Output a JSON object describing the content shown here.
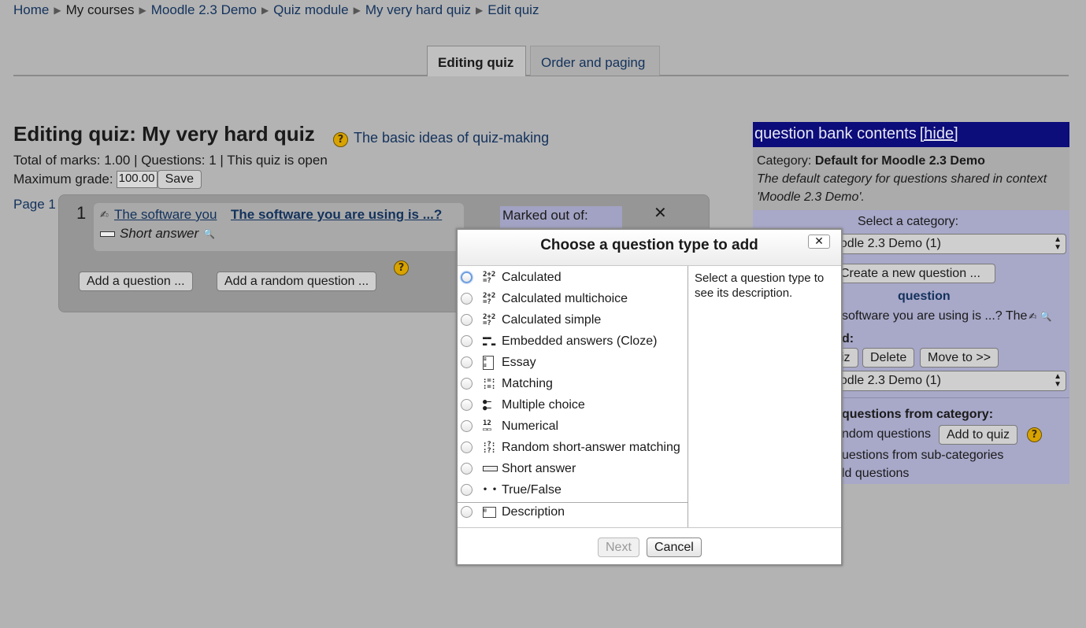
{
  "breadcrumb": {
    "items": [
      "Home",
      "My courses",
      "Moodle 2.3 Demo",
      "Quiz module",
      "My very hard quiz",
      "Edit quiz"
    ],
    "separator": "▶"
  },
  "tabs": {
    "editing": "Editing quiz",
    "order": "Order and paging"
  },
  "main": {
    "heading": "Editing quiz: My very hard quiz",
    "help_link": "The basic ideas of quiz-making",
    "summary": "Total of marks: 1.00 | Questions: 1 | This quiz is open",
    "max_grade_label": "Maximum grade:",
    "max_grade_value": "100.00",
    "save_label": "Save",
    "page_label": "Page 1",
    "slot_number": "1",
    "question_name_short": "The software you",
    "question_name_full": "The software you are using is ...?",
    "question_type": "Short answer",
    "marked_out_label": "Marked out of:",
    "remove_symbol": "✕",
    "add_question_label": "Add a question ...",
    "add_random_label": "Add a random question ..."
  },
  "qbank": {
    "header": "question bank contents",
    "hide_link": "[hide]",
    "category_prefix": "Category:",
    "category_name": "Default for Moodle 2.3 Demo",
    "category_desc": "The default category for questions shared in context 'Moodle 2.3 Demo'.",
    "select_label": "Select a category:",
    "select_value": "oodle 2.3 Demo (1)",
    "create_label": "Create a new question ...",
    "question_col": "question",
    "question_row": "software you are using is ...? The",
    "with_selected": "d:",
    "add_to_quiz_partial": "iz",
    "delete_label": "Delete",
    "move_to_label": "Move to >>",
    "move_select_value": "oodle 2.3 Demo (1)",
    "random_heading": "questions from category:",
    "random_row": "ndom questions",
    "add_to_quiz_label": "Add to quiz",
    "subcat_row": "uestions from sub-categories",
    "old_row": "ld questions"
  },
  "modal": {
    "title": "Choose a question type to add",
    "close_symbol": "✕",
    "types": [
      {
        "label": "Calculated",
        "icon": "calculated-icon"
      },
      {
        "label": "Calculated multichoice",
        "icon": "calculated-multichoice-icon"
      },
      {
        "label": "Calculated simple",
        "icon": "calculated-simple-icon"
      },
      {
        "label": "Embedded answers (Cloze)",
        "icon": "cloze-icon"
      },
      {
        "label": "Essay",
        "icon": "essay-icon"
      },
      {
        "label": "Matching",
        "icon": "matching-icon"
      },
      {
        "label": "Multiple choice",
        "icon": "multichoice-icon"
      },
      {
        "label": "Numerical",
        "icon": "numerical-icon"
      },
      {
        "label": "Random short-answer matching",
        "icon": "random-sa-matching-icon"
      },
      {
        "label": "Short answer",
        "icon": "short-answer-icon"
      },
      {
        "label": "True/False",
        "icon": "truefalse-icon"
      }
    ],
    "other_types": [
      {
        "label": "Description",
        "icon": "description-icon"
      }
    ],
    "description_text": "Select a question type to see its description.",
    "next_label": "Next",
    "cancel_label": "Cancel"
  },
  "colors": {
    "link": "#13325c",
    "qbank_header": "#0c0c7a",
    "qbank_body": "#a8a8c9",
    "overlay_bg": "#b3b3b3"
  }
}
